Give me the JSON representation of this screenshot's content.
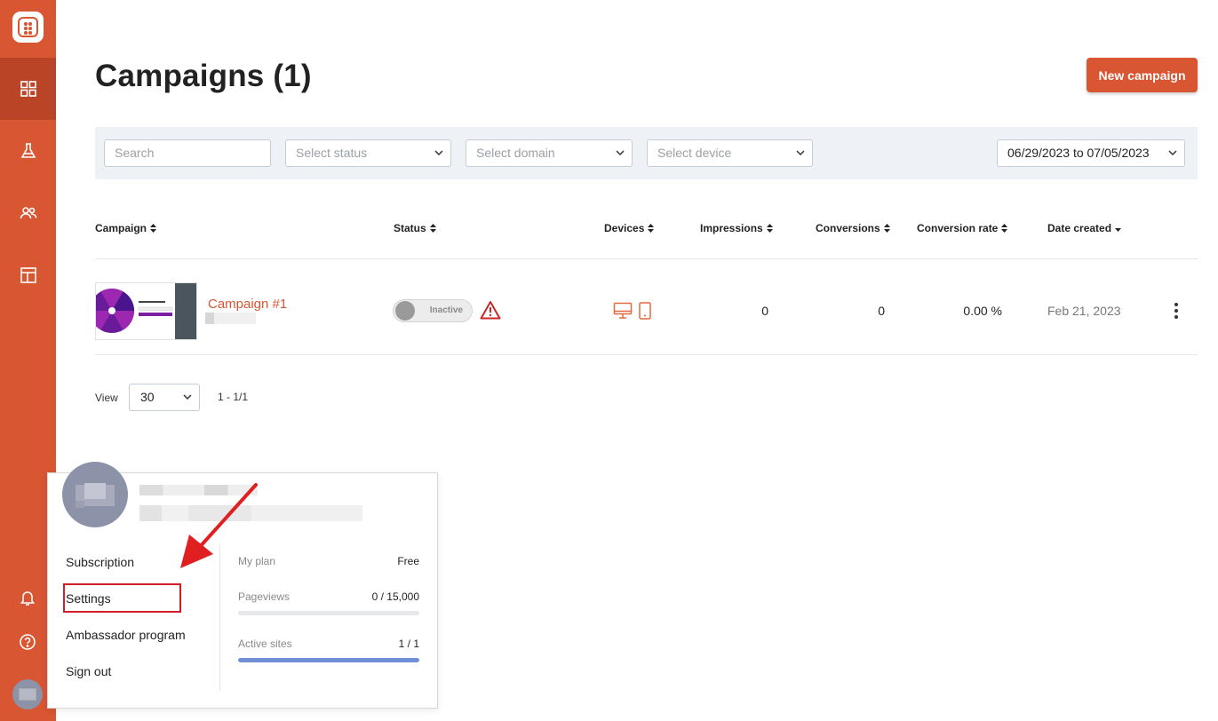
{
  "header": {
    "title": "Campaigns (1)",
    "new_button": "New campaign"
  },
  "filters": {
    "search_placeholder": "Search",
    "status_placeholder": "Select status",
    "domain_placeholder": "Select domain",
    "device_placeholder": "Select device",
    "date_range": "06/29/2023 to 07/05/2023"
  },
  "table": {
    "columns": {
      "campaign": "Campaign",
      "status": "Status",
      "devices": "Devices",
      "impressions": "Impressions",
      "conversions": "Conversions",
      "conversion_rate": "Conversion rate",
      "date_created": "Date created"
    },
    "rows": [
      {
        "name": "Campaign #1",
        "status": "Inactive",
        "impressions": "0",
        "conversions": "0",
        "conversion_rate": "0.00 %",
        "date_created": "Feb 21, 2023"
      }
    ]
  },
  "pagination": {
    "view_label": "View",
    "per_page": "30",
    "range": "1 - 1/1"
  },
  "account_menu": {
    "items": [
      "Subscription",
      "Settings",
      "Ambassador program",
      "Sign out"
    ],
    "plan_label": "My plan",
    "plan_value": "Free",
    "pageviews_label": "Pageviews",
    "pageviews_value": "0 / 15,000",
    "pageviews_fraction": 0.0,
    "sites_label": "Active sites",
    "sites_value": "1 / 1",
    "sites_fraction": 1.0
  },
  "colors": {
    "brand": "#d85632",
    "brand_dark": "#b94526",
    "highlight": "#d11f2a",
    "bar_fill": "#6f8fd6"
  },
  "icons": [
    "dashboard-icon",
    "flask-icon",
    "users-icon",
    "layout-icon",
    "bell-icon",
    "help-icon",
    "desktop-icon",
    "mobile-icon",
    "warning-icon"
  ]
}
